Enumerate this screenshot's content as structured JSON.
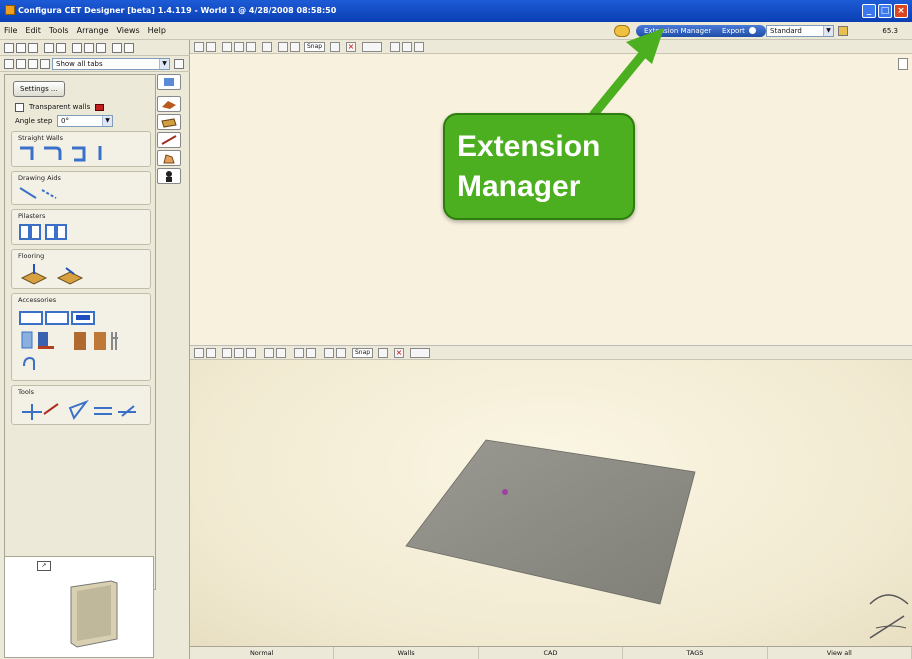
{
  "window": {
    "title": "Configura CET Designer [beta] 1.4.119 - World 1 @ 4/28/2008 08:58:50"
  },
  "menu": {
    "items": [
      "File",
      "Edit",
      "Tools",
      "Arrange",
      "Views",
      "Help"
    ]
  },
  "topbar": {
    "extension_manager_label": "Extension Manager",
    "export_label": "Export",
    "mode_value": "Standard",
    "zoom_value": "65.3"
  },
  "left": {
    "tab_filter_value": "Show all tabs",
    "settings_label": "Settings ...",
    "transparent_walls_label": "Transparent walls",
    "angle_step_label": "Angle step",
    "angle_step_value": "0°",
    "groups": {
      "straight_walls": "Straight Walls",
      "drawing_aids": "Drawing Aids",
      "pilasters": "Pilasters",
      "flooring": "Flooring",
      "accessories": "Accessories",
      "tools": "Tools"
    }
  },
  "views": {
    "snap_label": "Snap"
  },
  "statusbar": {
    "tabs": [
      "Normal",
      "Walls",
      "CAD",
      "TAGS",
      "View all"
    ]
  },
  "callout": {
    "line1": "Extension",
    "line2": "Manager"
  },
  "colors": {
    "callout_green": "#4caf1f",
    "titlebar_blue": "#0a3fb3",
    "floor_gray": "#8f8f88"
  }
}
